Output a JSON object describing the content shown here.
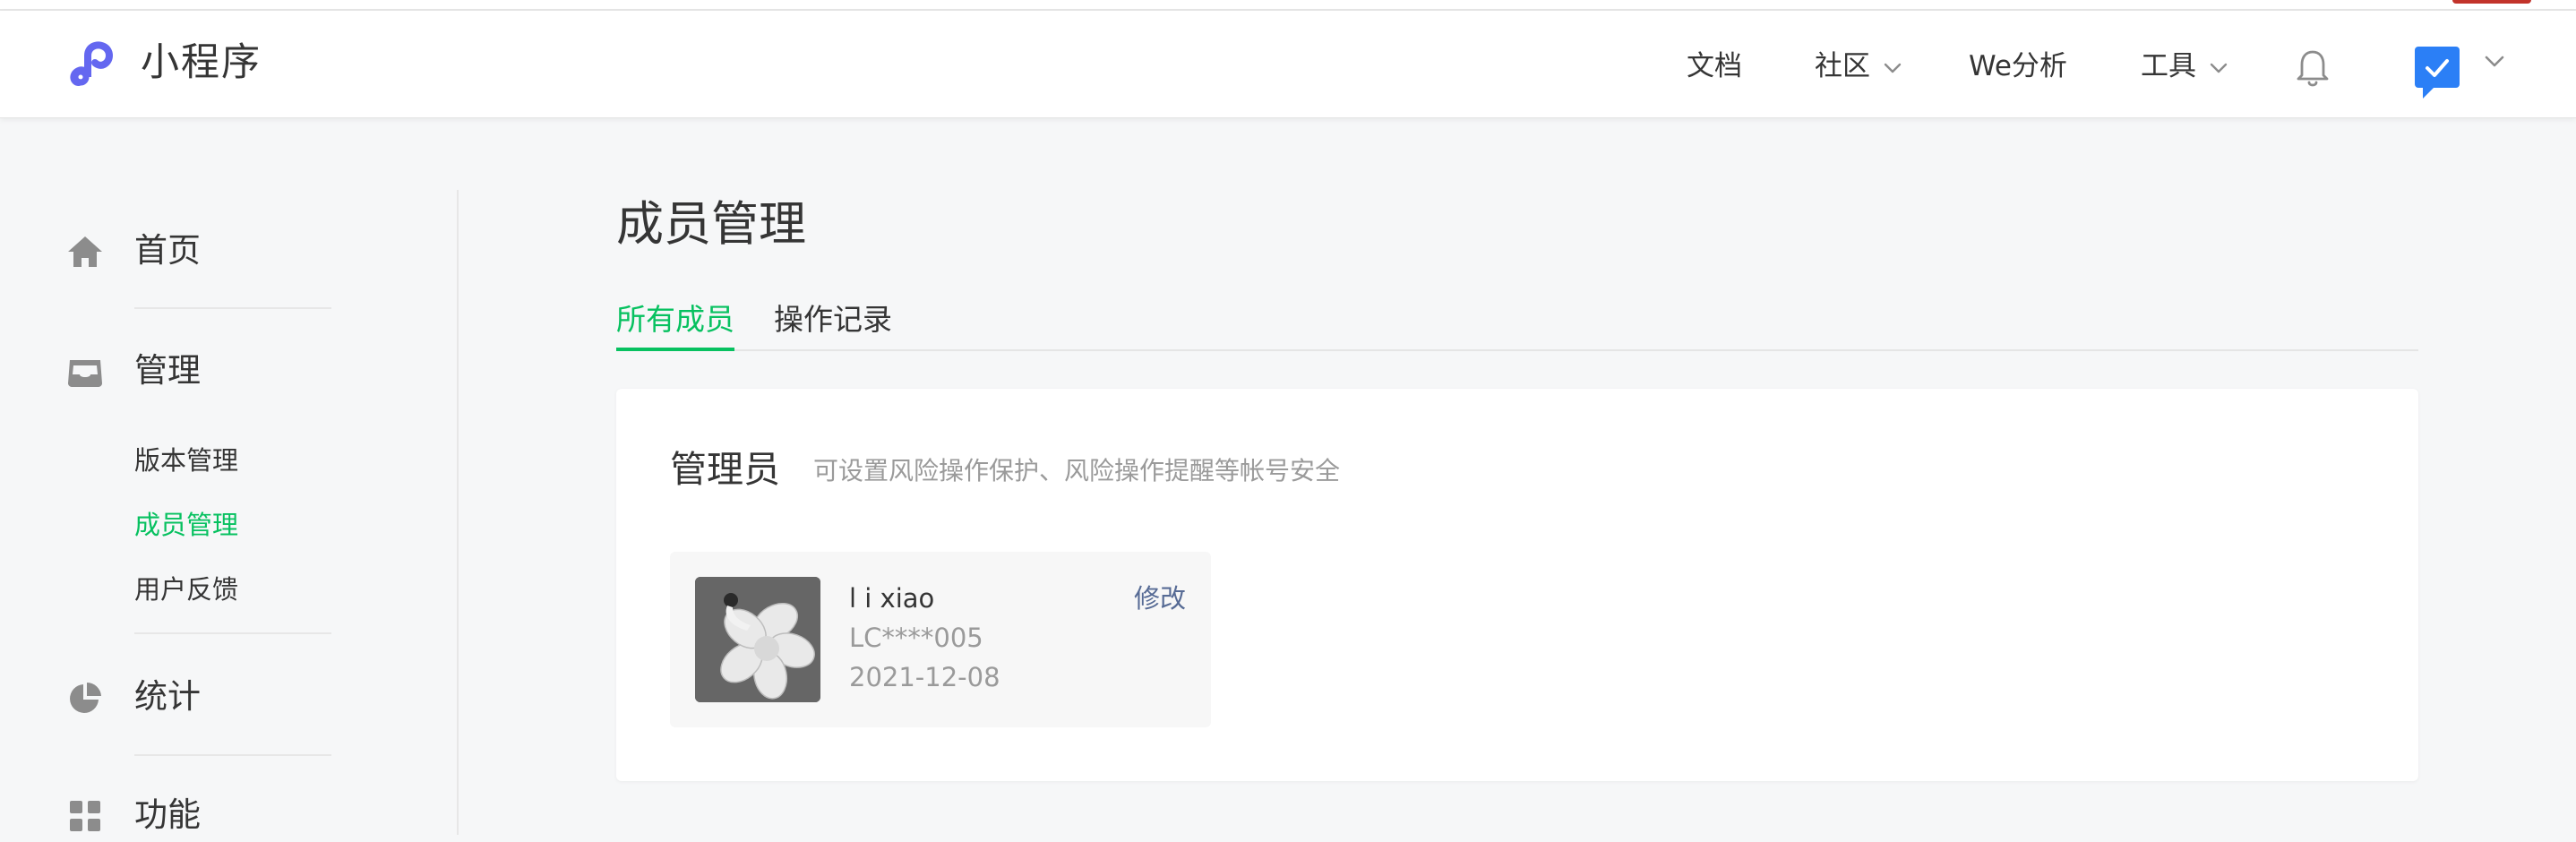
{
  "header": {
    "brand": "小程序",
    "nav": {
      "docs": "文档",
      "community": "社区",
      "analytics": "We分析",
      "tools": "工具"
    }
  },
  "sidebar": {
    "home": "首页",
    "manage": "管理",
    "manage_items": [
      "版本管理",
      "成员管理",
      "用户反馈"
    ],
    "stats": "统计",
    "features": "功能"
  },
  "main": {
    "title": "成员管理",
    "tabs": [
      "所有成员",
      "操作记录"
    ],
    "section": {
      "title": "管理员",
      "description": "可设置风险操作保护、风险操作提醒等帐号安全"
    },
    "member": {
      "name": "l i xiao",
      "id": "LC****005",
      "date": "2021-12-08",
      "edit_label": "修改"
    }
  },
  "colors": {
    "accent_green": "#07c160",
    "link_blue": "#576b95",
    "logo_purple": "#6467f0",
    "badge_blue": "#2b7ff6"
  }
}
